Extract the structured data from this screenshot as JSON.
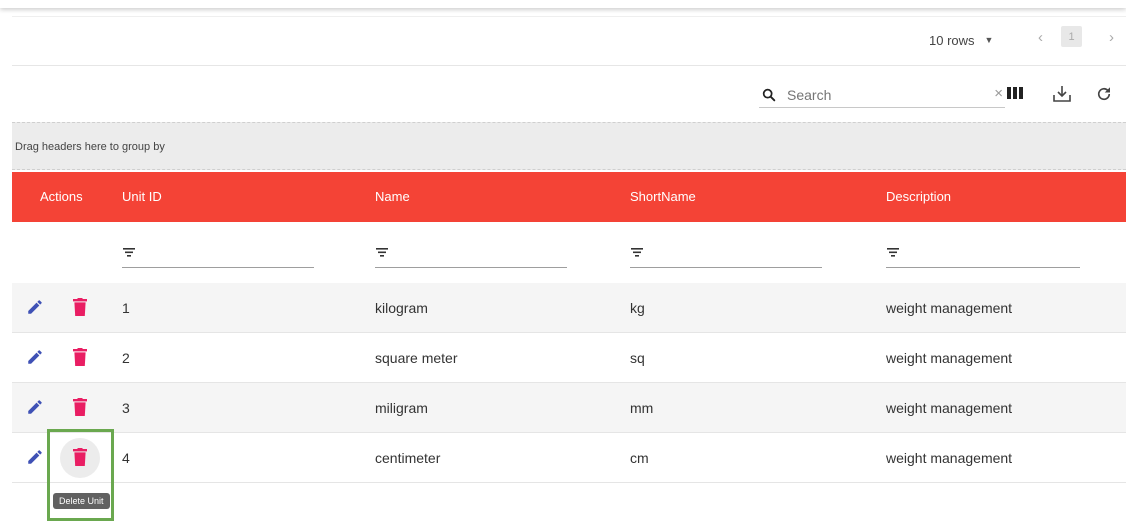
{
  "pagination": {
    "rows_label": "10 rows",
    "prev": "‹",
    "page": "1",
    "next": "›"
  },
  "toolbar": {
    "search_placeholder": "Search",
    "clear": "×",
    "icons": [
      "search-icon",
      "view-column-icon",
      "download-icon",
      "refresh-icon"
    ]
  },
  "groupby": {
    "text": "Drag headers here to group by"
  },
  "table": {
    "header_color": "#f44336",
    "columns": {
      "actions": "Actions",
      "unit_id": "Unit ID",
      "name": "Name",
      "short_name": "ShortName",
      "description": "Description"
    },
    "rows": [
      {
        "id": "1",
        "name": "kilogram",
        "short": "kg",
        "description": "weight management"
      },
      {
        "id": "2",
        "name": "square meter",
        "short": "sq",
        "description": "weight management"
      },
      {
        "id": "3",
        "name": "miligram",
        "short": "mm",
        "description": "weight management"
      },
      {
        "id": "4",
        "name": "centimeter",
        "short": "cm",
        "description": "weight management"
      }
    ]
  },
  "tooltip": {
    "text": "Delete Unit"
  },
  "colors": {
    "edit": "#3f51b5",
    "delete": "#e91e63",
    "highlight": "#6aa84f"
  }
}
